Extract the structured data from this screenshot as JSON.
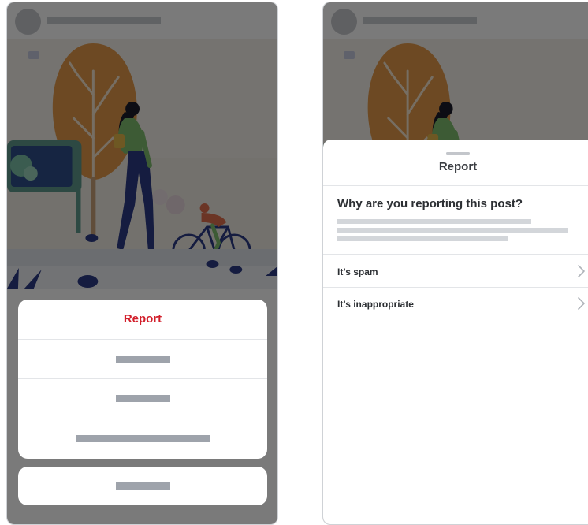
{
  "left_screen": {
    "action_sheet": {
      "report_label": "Report"
    }
  },
  "right_screen": {
    "report_sheet": {
      "title": "Report",
      "question": "Why are you reporting this post?",
      "reasons": [
        {
          "label": "It’s spam"
        },
        {
          "label": "It’s inappropriate"
        }
      ]
    }
  },
  "colors": {
    "report_red": "#d21f2b",
    "overlay": "rgba(0,0,0,0.52)",
    "placeholder": "#9ea3ab"
  },
  "icons": [
    "chevron-right-icon"
  ]
}
